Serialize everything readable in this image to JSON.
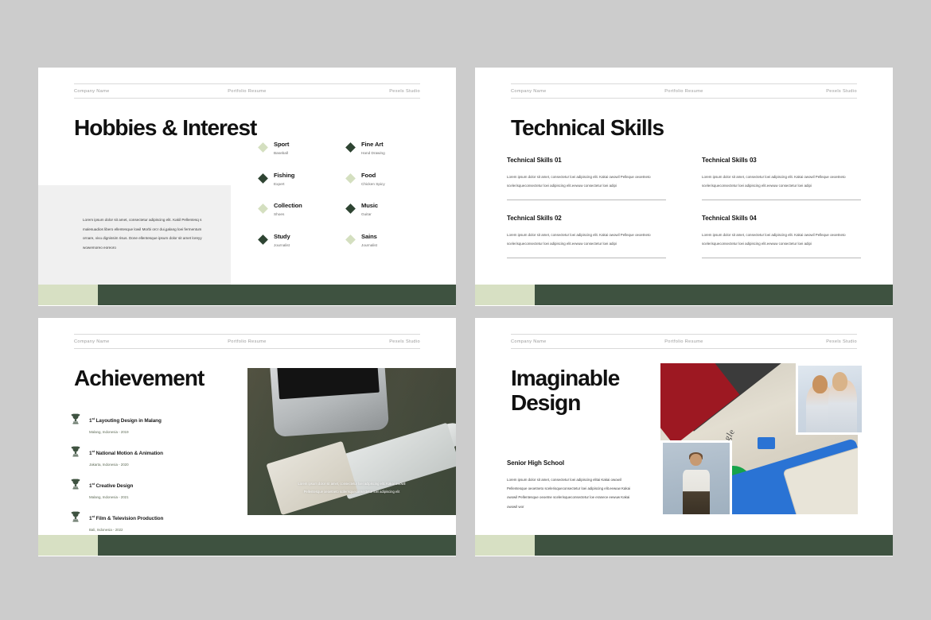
{
  "palette": {
    "page_background": "#cccccc",
    "slide_background": "#ffffff",
    "accent_dark_green": "#3e5240",
    "accent_light_green": "#d7e0c3",
    "diamond_dark": "#2e4432",
    "diamond_light": "#d4dfc0",
    "panel_gray": "#f0f0f0",
    "header_text": "#9a9a9a"
  },
  "header": {
    "left": "Company Name",
    "center": "Portfolio Resume",
    "right": "Pexels Studio"
  },
  "slides": [
    {
      "id": "hobbies-interest",
      "title": "Hobbies & Interest",
      "paragraph": "Lorem ipsum dolor sit amet, consectetur adipiscing elit. Kakil Pellentesq s malesuadios libero ellentesque lowil Morbi orcr dui,galang loei fermentum ornare, vivu dignissim risus. Done ellentesque ipsum dolor sit amet loreyy wowemoreo eoreoro",
      "hobbies": [
        {
          "name": "Sport",
          "sub": "Baseball",
          "marker": "light"
        },
        {
          "name": "Fine Art",
          "sub": "Hand Drawing",
          "marker": "dark"
        },
        {
          "name": "Fishing",
          "sub": "Expert",
          "marker": "dark"
        },
        {
          "name": "Food",
          "sub": "Chicken Spicy",
          "marker": "light"
        },
        {
          "name": "Collection",
          "sub": "Shoes",
          "marker": "light"
        },
        {
          "name": "Music",
          "sub": "Guitar",
          "marker": "dark"
        },
        {
          "name": "Study",
          "sub": "Journalist",
          "marker": "dark"
        },
        {
          "name": "Sains",
          "sub": "Journalist",
          "marker": "light"
        }
      ]
    },
    {
      "id": "technical-skills",
      "title": "Technical Skills",
      "skills": [
        {
          "heading": "Technical Skills 01",
          "body": "Lorem ipsum dolor sit amet, consectetur loei adipiscing elit. Kakai owowil Pelleque oeoetneto scelerisqueconsectetur loei adipiscing elit.eewuw consectetur loei adipi"
        },
        {
          "heading": "Technical Skills 03",
          "body": "Lorem ipsum dolor sit amet, consectetur loei adipiscing elit. Kakai owowil Pelleque oeoetneto scelerisqueconsectetur loei adipiscing elit.eewuw consectetur loei adipi"
        },
        {
          "heading": "Technical Skills 02",
          "body": "Lorem ipsum dolor sit amet, consectetur loei adipiscing elit. Kakai owowil Pelleque oeoetneto scelerisqueconsectetur loei adipiscing elit.eewuw consectetur loei adipi"
        },
        {
          "heading": "Technical Skills 04",
          "body": "Lorem ipsum dolor sit amet, consectetur loei adipiscing elit. Kakai owowil Pelleque oeoetneto scelerisqueconsectetur loei adipiscing elit.eewuw consectetur loei adipi"
        }
      ]
    },
    {
      "id": "achievement",
      "title": "Achievement",
      "achievements": [
        {
          "rank": "1",
          "ordinal": "st",
          "name": " Layouting Design in Malang",
          "location": "Malang, Indonesia - 2019"
        },
        {
          "rank": "1",
          "ordinal": "st",
          "name": " National Motion & Animation",
          "location": "Jakarta, Indonesia - 2020"
        },
        {
          "rank": "1",
          "ordinal": "st",
          "name": " Creative Design",
          "location": "Malang, Indonesia - 2021"
        },
        {
          "rank": "1",
          "ordinal": "st",
          "name": " Film & Television Production",
          "location": "Bali, Indonesia - 2022"
        }
      ],
      "photo_caption_line1": "Lorem ipsum dolor sit amet, consectetur loei adipiscing elit. Kakai owowil",
      "photo_caption_line2": "Pellentesque oeoetneto scilerisqueconsectetur loei adipiscing elit",
      "photo_alt": "desk-with-imac-keyboard-and-notebook"
    },
    {
      "id": "imaginable-design",
      "title": "Imaginable Design",
      "section_heading": "Senior High School",
      "paragraph": "Lorem ipsum dolor sit amet, consectetur loei adipiscing elitai Kakai owowil Pellentesque oeoetneto scelerisqueconsectetur loei adipiscing elit.eewuw Kakai owowil Pellentesque oeoetne scelerisqueconsectetur loe eranece eewuw Kakai owowil wor",
      "photos": [
        {
          "alt": "google-pixel-product-photography"
        },
        {
          "alt": "two-models-portrait"
        },
        {
          "alt": "fashion-model-standing"
        }
      ]
    }
  ]
}
